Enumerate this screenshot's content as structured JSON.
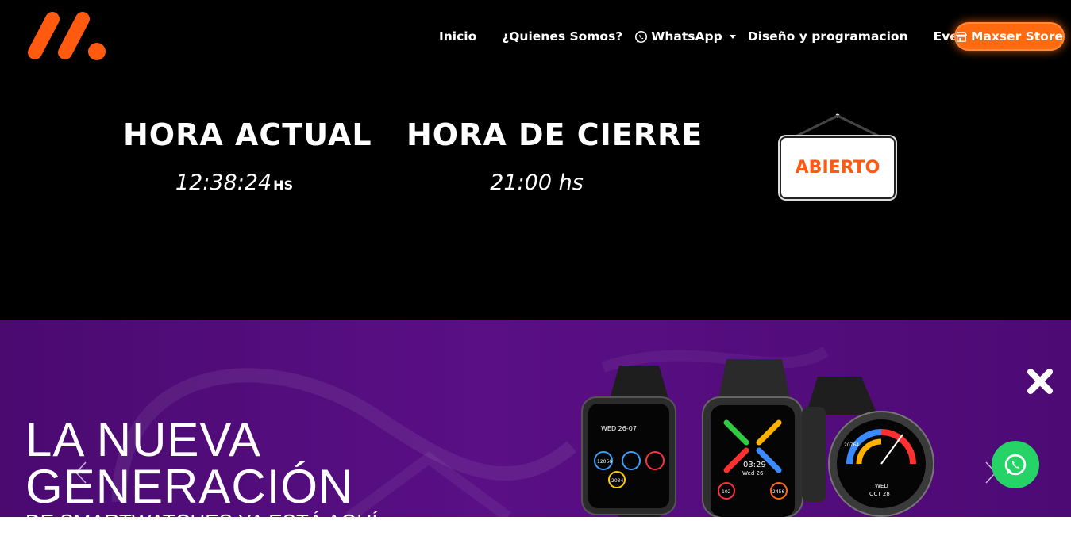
{
  "nav": {
    "items": [
      {
        "label": "Inicio"
      },
      {
        "label": "¿Quienes Somos?"
      },
      {
        "label": "WhatsApp"
      },
      {
        "label": "Diseño y programacion"
      },
      {
        "label": "Eventos"
      }
    ],
    "store_label": "Maxser Store"
  },
  "clock": {
    "current_title": "HORA ACTUAL",
    "current_time": "12:38:24",
    "current_unit": "HS",
    "closing_title": "HORA DE CIERRE",
    "closing_time": "21:00 hs",
    "status": "ABIERTO"
  },
  "banner": {
    "line1": "LA NUEVA",
    "line2": "GENERACIÓN",
    "line3": "DE SMARTWATCHES YA ESTÁ AQUÍ",
    "watch_left": {
      "date": "WED 26-07",
      "time": "10:15",
      "steps": "12056",
      "cal": "2034"
    },
    "watch_middle": {
      "time": "03:29",
      "date": "Wed 26",
      "hr": "102",
      "cal": "2456"
    },
    "watch_right": {
      "steps": "20764",
      "date": "WED",
      "date2": "OCT 28"
    }
  },
  "colors": {
    "accent": "#ff6a10",
    "banner_bg": "#4f0b78",
    "whatsapp": "#25d366"
  }
}
